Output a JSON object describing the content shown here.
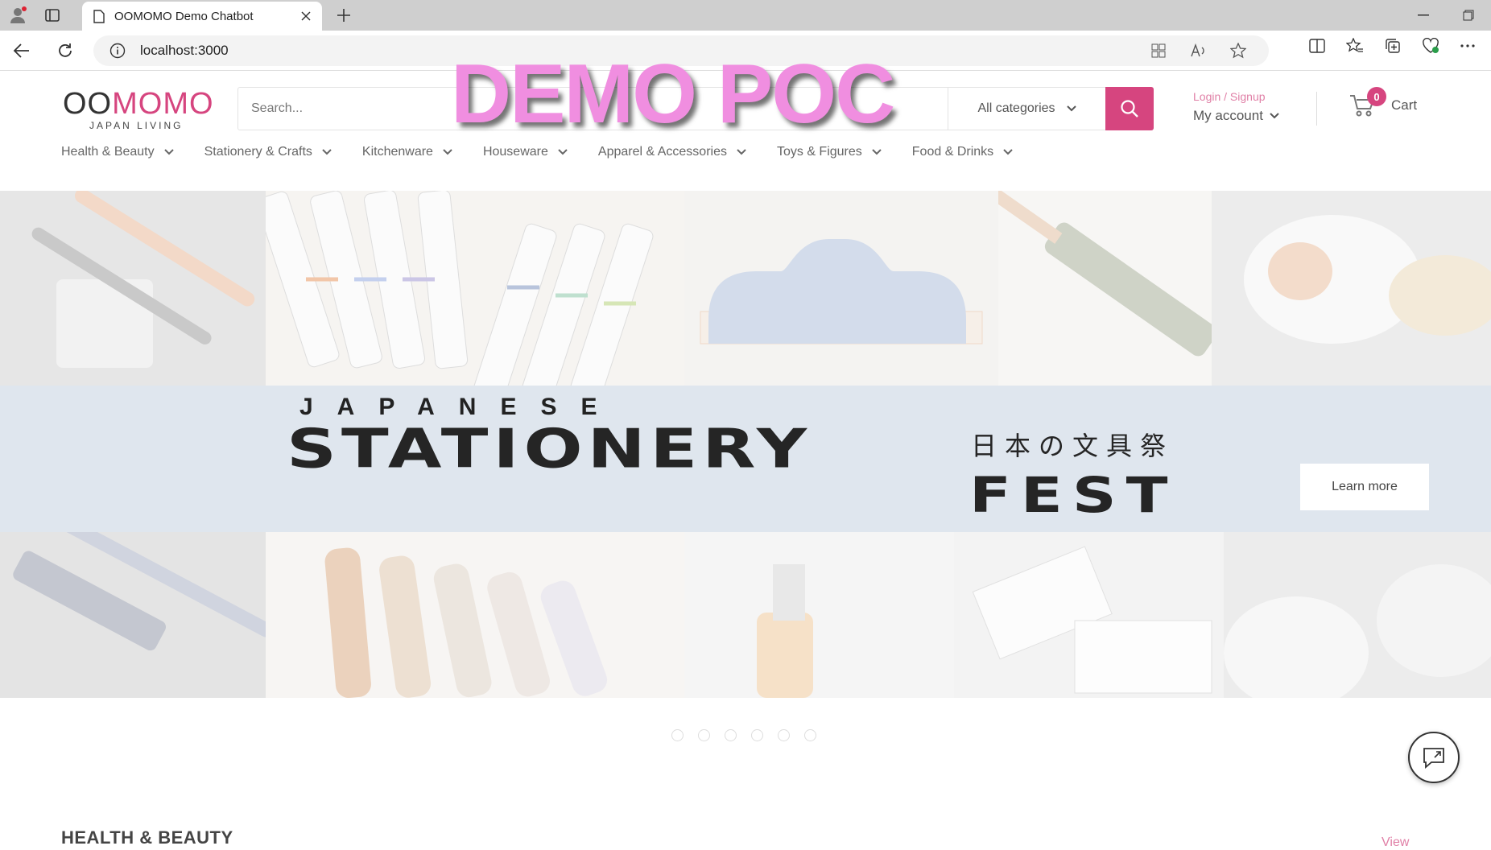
{
  "browser": {
    "tab_title": "OOMOMO Demo Chatbot",
    "url": "localhost:3000"
  },
  "logo": {
    "part1": "OO",
    "part2": "MOMO",
    "subtitle": "JAPAN LIVING"
  },
  "search": {
    "placeholder": "Search...",
    "category": "All categories"
  },
  "account": {
    "login": "Login / Signup",
    "my_account": "My account"
  },
  "cart": {
    "count": "0",
    "label": "Cart"
  },
  "nav": [
    "Health & Beauty",
    "Stationery & Crafts",
    "Kitchenware",
    "Houseware",
    "Apparel & Accessories",
    "Toys & Figures",
    "Food & Drinks"
  ],
  "watermark": "DEMO POC",
  "hero": {
    "kicker": "JAPANESE",
    "title": "STATIONERY",
    "jp": "日本の文具祭",
    "fest": "FEST",
    "cta": "Learn more",
    "slide_count": 6
  },
  "section": {
    "title": "HEALTH & BEAUTY",
    "view_link": "View"
  },
  "colors": {
    "brand": "#d6457f",
    "link": "#e07fa6",
    "watermark": "#f08ee0"
  }
}
